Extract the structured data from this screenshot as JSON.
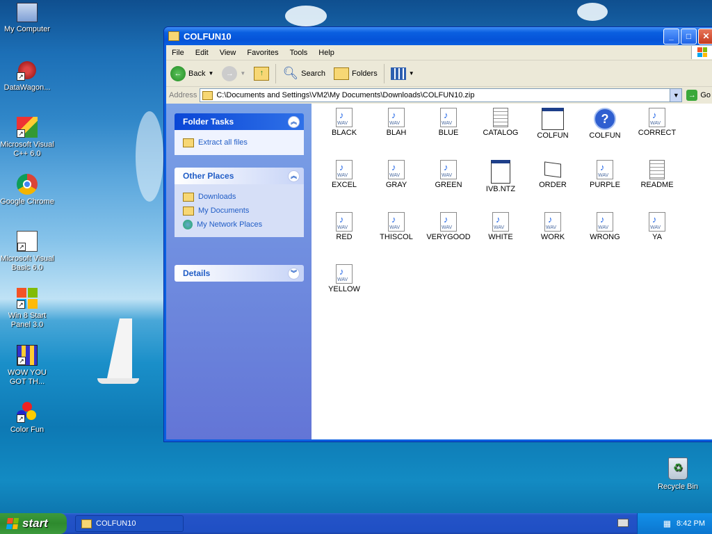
{
  "desktop": {
    "icons": [
      {
        "label": "My Computer"
      },
      {
        "label": "DataWagon..."
      },
      {
        "label": "Microsoft Visual C++ 6.0"
      },
      {
        "label": "Google Chrome"
      },
      {
        "label": "Microsoft Visual Basic 6.0"
      },
      {
        "label": "Win 8 Start Panel 3.0"
      },
      {
        "label": "WOW YOU GOT TH..."
      },
      {
        "label": "Color Fun"
      },
      {
        "label": "Recycle Bin"
      }
    ]
  },
  "window": {
    "title": "COLFUN10",
    "menu": [
      "File",
      "Edit",
      "View",
      "Favorites",
      "Tools",
      "Help"
    ],
    "toolbar": {
      "back": "Back",
      "search": "Search",
      "folders": "Folders"
    },
    "address": {
      "label": "Address",
      "value": "C:\\Documents and Settings\\VM2\\My Documents\\Downloads\\COLFUN10.zip",
      "go": "Go"
    },
    "sidebar": {
      "folder_tasks": {
        "title": "Folder Tasks",
        "items": [
          "Extract all files"
        ]
      },
      "other_places": {
        "title": "Other Places",
        "items": [
          "Downloads",
          "My Documents",
          "My Network Places"
        ]
      },
      "details": {
        "title": "Details"
      }
    },
    "files": [
      {
        "name": "BLACK",
        "icon": "wav-audio-icon"
      },
      {
        "name": "BLAH",
        "icon": "wav-audio-icon"
      },
      {
        "name": "BLUE",
        "icon": "wav-audio-icon"
      },
      {
        "name": "CATALOG",
        "icon": "text-document-icon"
      },
      {
        "name": "COLFUN",
        "icon": "application-window-icon"
      },
      {
        "name": "COLFUN",
        "icon": "help-file-icon"
      },
      {
        "name": "CORRECT",
        "icon": "wav-audio-icon"
      },
      {
        "name": "EXCEL",
        "icon": "wav-audio-icon"
      },
      {
        "name": "GRAY",
        "icon": "wav-audio-icon"
      },
      {
        "name": "GREEN",
        "icon": "wav-audio-icon"
      },
      {
        "name": "IVB.NTZ",
        "icon": "ntz-file-icon"
      },
      {
        "name": "ORDER",
        "icon": "file-icon"
      },
      {
        "name": "PURPLE",
        "icon": "wav-audio-icon"
      },
      {
        "name": "README",
        "icon": "text-document-icon"
      },
      {
        "name": "RED",
        "icon": "wav-audio-icon"
      },
      {
        "name": "THISCOL",
        "icon": "wav-audio-icon"
      },
      {
        "name": "VERYGOOD",
        "icon": "wav-audio-icon"
      },
      {
        "name": "WHITE",
        "icon": "wav-audio-icon"
      },
      {
        "name": "WORK",
        "icon": "wav-audio-icon"
      },
      {
        "name": "WRONG",
        "icon": "wav-audio-icon"
      },
      {
        "name": "YA",
        "icon": "wav-audio-icon"
      },
      {
        "name": "YELLOW",
        "icon": "wav-audio-icon"
      }
    ]
  },
  "taskbar": {
    "start_label": "start",
    "task_label": "COLFUN10",
    "clock": "8:42 PM"
  },
  "colors": {
    "title_blue": "#0a5fe0",
    "start_green": "#3c9a3c",
    "link_blue": "#215dc6"
  }
}
